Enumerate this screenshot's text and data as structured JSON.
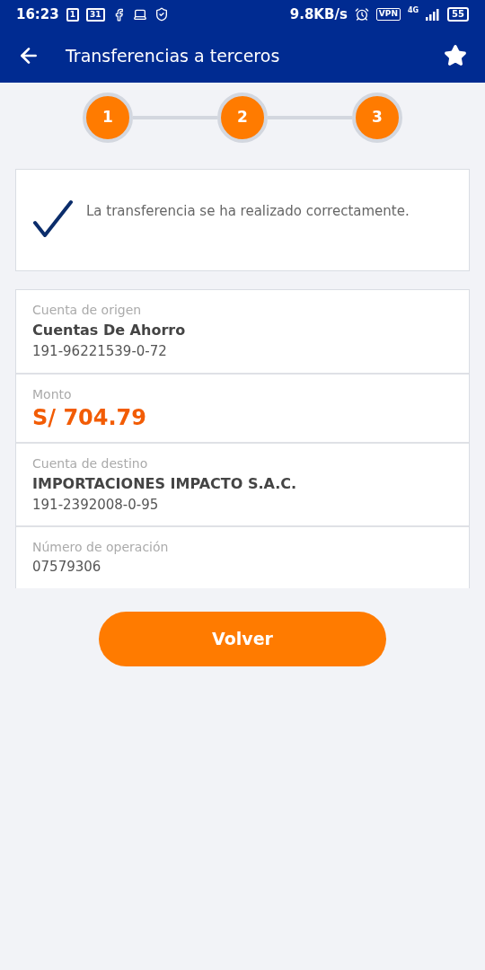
{
  "status_bar": {
    "time": "16:23",
    "calendar_badges": [
      "1",
      "31"
    ],
    "speed": "9.8KB/s",
    "vpn": "VPN",
    "network": "4G",
    "battery": "55"
  },
  "header": {
    "title": "Transferencias a terceros"
  },
  "steps": [
    {
      "label": "1",
      "done": true
    },
    {
      "label": "2",
      "done": true
    },
    {
      "label": "3",
      "done": true
    }
  ],
  "message": "La transferencia se ha realizado correctamente.",
  "details": [
    {
      "label": "Cuenta de origen",
      "lines": [
        {
          "kind": "name",
          "text": "Cuentas De Ahorro"
        },
        {
          "kind": "plain",
          "text": "191-96221539-0-72"
        }
      ]
    },
    {
      "label": "Monto",
      "lines": [
        {
          "kind": "amount",
          "text": "S/ 704.79"
        }
      ]
    },
    {
      "label": "Cuenta de destino",
      "lines": [
        {
          "kind": "name",
          "text": "IMPORTACIONES IMPACTO S.A.C."
        },
        {
          "kind": "plain",
          "text": "191-2392008-0-95"
        }
      ]
    },
    {
      "label": "Número de operación",
      "lines": [
        {
          "kind": "plain",
          "text": "07579306"
        }
      ]
    }
  ],
  "button": "Volver"
}
